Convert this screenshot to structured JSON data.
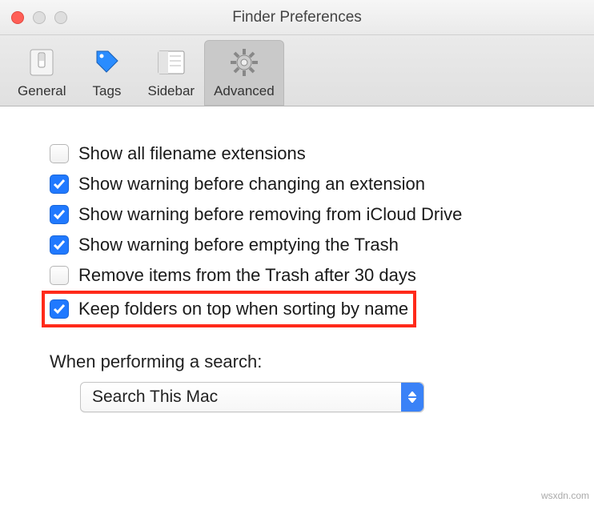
{
  "window": {
    "title": "Finder Preferences"
  },
  "tabs": {
    "general": "General",
    "tags": "Tags",
    "sidebar": "Sidebar",
    "advanced": "Advanced",
    "selected": "advanced"
  },
  "options": {
    "show_ext": {
      "label": "Show all filename extensions",
      "checked": false
    },
    "warn_ext": {
      "label": "Show warning before changing an extension",
      "checked": true
    },
    "warn_icloud": {
      "label": "Show warning before removing from iCloud Drive",
      "checked": true
    },
    "warn_trash": {
      "label": "Show warning before emptying the Trash",
      "checked": true
    },
    "remove_30": {
      "label": "Remove items from the Trash after 30 days",
      "checked": false
    },
    "folders_top": {
      "label": "Keep folders on top when sorting by name",
      "checked": true
    }
  },
  "search": {
    "label": "When performing a search:",
    "value": "Search This Mac"
  },
  "watermark": "wsxdn.com"
}
